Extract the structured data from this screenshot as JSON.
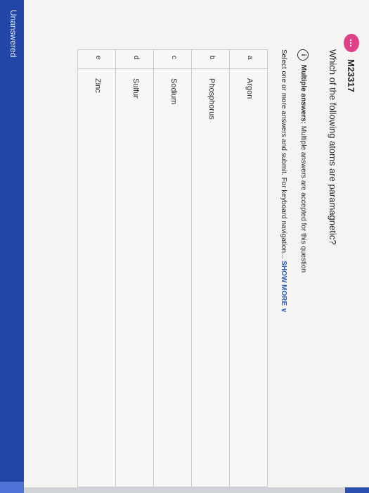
{
  "question": {
    "badge": "...",
    "id": "M23317",
    "text": "Which of the following atoms are paramagnetic?"
  },
  "notice": {
    "icon": "info-icon",
    "icon_glyph": "i",
    "title": "Multiple answers:",
    "body": "Multiple answers are accepted for this question"
  },
  "instructions": {
    "text": "Select one or more answers and submit. For keyboard navigation...",
    "show_more": "SHOW MORE",
    "chevron": "∨"
  },
  "choices": [
    {
      "letter": "a",
      "label": "Argon"
    },
    {
      "letter": "b",
      "label": "Phosphorus"
    },
    {
      "letter": "c",
      "label": "Sodium"
    },
    {
      "letter": "d",
      "label": "Sulfur"
    },
    {
      "letter": "e",
      "label": "Zinc"
    }
  ],
  "footer": {
    "status": "Unanswered"
  },
  "colors": {
    "accent_blue": "#2146a8",
    "badge_pink": "#e0428a",
    "link_blue": "#2c5bc7"
  }
}
